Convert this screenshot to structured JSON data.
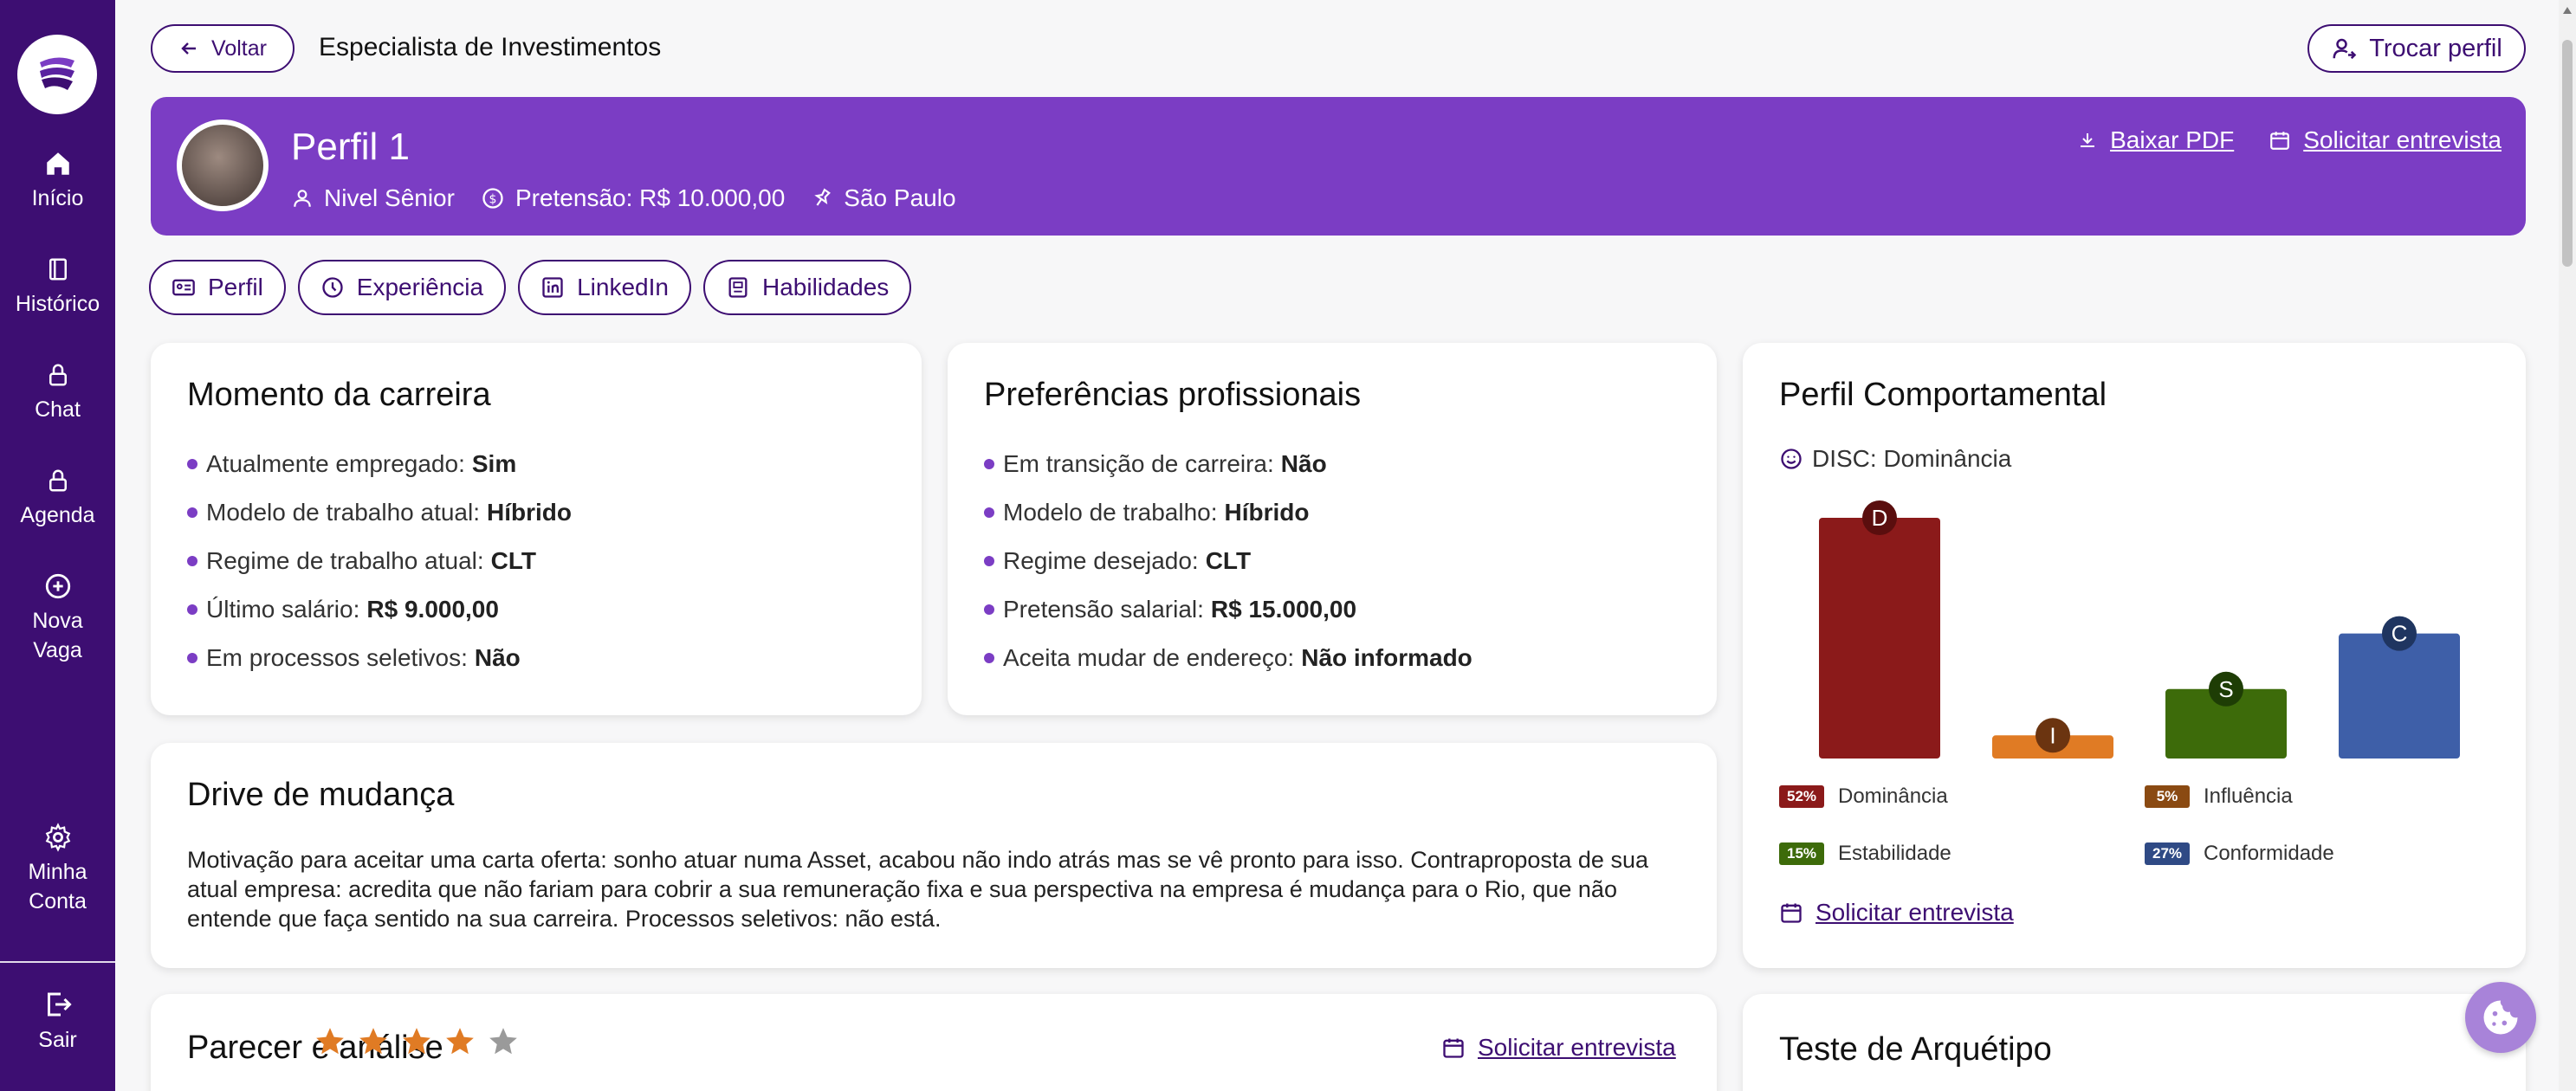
{
  "sidebar": {
    "items": [
      {
        "label": "Início",
        "icon": "home-icon"
      },
      {
        "label": "Histórico",
        "icon": "book-icon"
      },
      {
        "label": "Chat",
        "icon": "lock-icon"
      },
      {
        "label": "Agenda",
        "icon": "lock-icon"
      },
      {
        "label_line1": "Nova",
        "label_line2": "Vaga",
        "icon": "plus-circle-icon"
      }
    ],
    "account": {
      "label_line1": "Minha",
      "label_line2": "Conta",
      "icon": "gear-icon"
    },
    "logout": {
      "label": "Sair",
      "icon": "logout-icon"
    },
    "colors": {
      "background": "#3d0e72"
    }
  },
  "header": {
    "back_label": "Voltar",
    "title": "Especialista de Investimentos",
    "switch_profile_label": "Trocar perfil"
  },
  "banner": {
    "name": "Perfil 1",
    "level": "Nivel Sênior",
    "salary_expectation": "Pretensão: R$ 10.000,00",
    "location": "São Paulo",
    "download_pdf": "Baixar PDF",
    "request_interview": "Solicitar entrevista",
    "color": "#7b3dc4"
  },
  "tabs": [
    {
      "label": "Perfil",
      "icon": "id-card-icon"
    },
    {
      "label": "Experiência",
      "icon": "clock-icon"
    },
    {
      "label": "LinkedIn",
      "icon": "linkedin-icon"
    },
    {
      "label": "Habilidades",
      "icon": "skills-icon"
    }
  ],
  "career_moment": {
    "title": "Momento da carreira",
    "items": [
      {
        "label": "Atualmente empregado:",
        "value": "Sim"
      },
      {
        "label": "Modelo de trabalho atual:",
        "value": "Híbrido"
      },
      {
        "label": "Regime de trabalho atual:",
        "value": "CLT"
      },
      {
        "label": "Último salário:",
        "value": "R$ 9.000,00"
      },
      {
        "label": "Em processos seletivos:",
        "value": "Não"
      }
    ]
  },
  "preferences": {
    "title": "Preferências profissionais",
    "items": [
      {
        "label": "Em transição de carreira:",
        "value": "Não"
      },
      {
        "label": "Modelo de trabalho:",
        "value": "Híbrido"
      },
      {
        "label": "Regime desejado:",
        "value": "CLT"
      },
      {
        "label": "Pretensão salarial:",
        "value": "R$ 15.000,00"
      },
      {
        "label": "Aceita mudar de endereço:",
        "value": "Não informado"
      }
    ]
  },
  "behavioral": {
    "title": "Perfil Comportamental",
    "disc_label": "DISC: Dominância",
    "request_interview": "Solicitar entrevista"
  },
  "chart_data": {
    "type": "bar",
    "categories": [
      "D",
      "I",
      "S",
      "C"
    ],
    "values": [
      52,
      5,
      15,
      27
    ],
    "colors": [
      "#8b1a1a",
      "#e07b24",
      "#3d6b0a",
      "#3e5fa8"
    ],
    "label_colors": [
      "#5a0e0e",
      "#6b3410",
      "#1e3d05",
      "#1f3560"
    ],
    "legend": [
      {
        "badge": "52%",
        "label": "Dominância",
        "color": "#8b1a1a"
      },
      {
        "badge": "5%",
        "label": "Influência",
        "color": "#8a4a12"
      },
      {
        "badge": "15%",
        "label": "Estabilidade",
        "color": "#3d6b0a"
      },
      {
        "badge": "27%",
        "label": "Conformidade",
        "color": "#2f4a85"
      }
    ]
  },
  "drive": {
    "title": "Drive de mudança",
    "text": "Motivação para aceitar uma carta oferta: sonho atuar numa Asset, acabou não indo atrás mas se vê pronto para isso. Contraproposta de sua atual empresa: acredita que não fariam para cobrir a sua remuneração fixa e sua perspectiva na empresa é mudança para o Rio, que não entende que faça sentido na sua carreira. Processos seletivos: não está."
  },
  "analysis": {
    "title": "Parecer e análise",
    "rating": 4,
    "max_rating": 5,
    "request_interview": "Solicitar entrevista"
  },
  "archetype": {
    "title": "Teste de Arquétipo"
  }
}
